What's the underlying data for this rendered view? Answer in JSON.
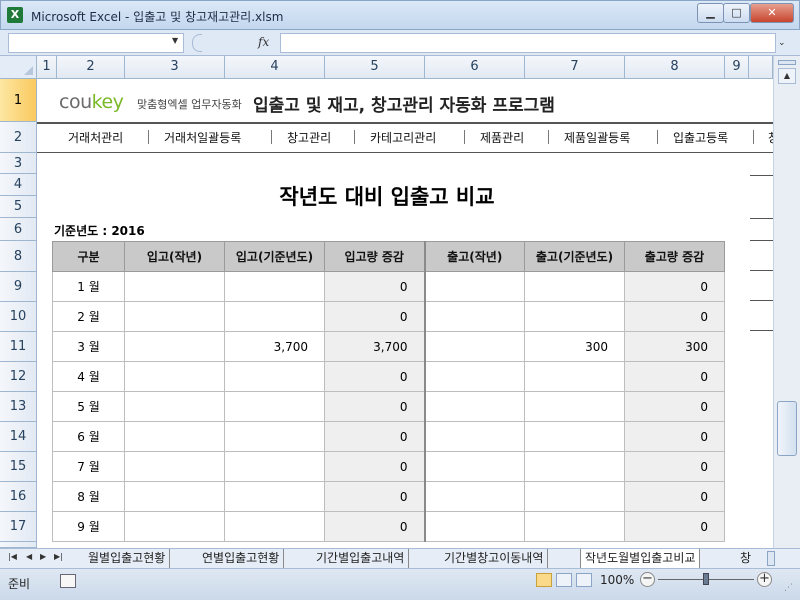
{
  "window": {
    "title": "Microsoft Excel - 입출고 및 창고재고관리.xlsm",
    "app_icon": "X",
    "minimize_icon": "minimize-icon",
    "maximize_icon": "maximize-icon",
    "close_icon": "close-icon"
  },
  "formula_bar": {
    "name_box": "",
    "fx_label": "fx",
    "formula": ""
  },
  "columns": [
    "1",
    "2",
    "3",
    "4",
    "5",
    "6",
    "7",
    "8",
    "9"
  ],
  "rows": [
    "1",
    "2",
    "3",
    "4",
    "5",
    "6",
    "8",
    "9",
    "10",
    "11",
    "12",
    "13",
    "14",
    "15",
    "16",
    "17"
  ],
  "selected_row": "1",
  "header": {
    "logo_main": "cou",
    "logo_accent": "key",
    "logo_sub": "맞춤형엑셀 업무자동화",
    "title": "입출고 및 재고, 창고관리 자동화 프로그램"
  },
  "nav": {
    "items": [
      "거래처관리",
      "거래처일괄등록",
      "창고관리",
      "카테고리관리",
      "제품관리",
      "제품일괄등록",
      "입출고등록",
      "창"
    ]
  },
  "report": {
    "title": "작년도 대비 입출고 비교",
    "base_year": "기준년도 : 2016"
  },
  "table": {
    "headers": [
      "구분",
      "입고(작년)",
      "입고(기준년도)",
      "입고량 증감",
      "출고(작년)",
      "출고(기준년도)",
      "출고량 증감"
    ],
    "rows": [
      [
        "1 월",
        "",
        "",
        "0",
        "",
        "",
        "0"
      ],
      [
        "2 월",
        "",
        "",
        "0",
        "",
        "",
        "0"
      ],
      [
        "3 월",
        "",
        "3,700",
        "3,700",
        "",
        "300",
        "300"
      ],
      [
        "4 월",
        "",
        "",
        "0",
        "",
        "",
        "0"
      ],
      [
        "5 월",
        "",
        "",
        "0",
        "",
        "",
        "0"
      ],
      [
        "6 월",
        "",
        "",
        "0",
        "",
        "",
        "0"
      ],
      [
        "7 월",
        "",
        "",
        "0",
        "",
        "",
        "0"
      ],
      [
        "8 월",
        "",
        "",
        "0",
        "",
        "",
        "0"
      ],
      [
        "9 월",
        "",
        "",
        "0",
        "",
        "",
        "0"
      ]
    ]
  },
  "sheet_tabs": {
    "items": [
      "월별입출고현황",
      "연별입출고현황",
      "기간별입출고내역",
      "기간별창고이동내역",
      "작년도월별입출고비교",
      "창"
    ],
    "active": "작년도월별입출고비교"
  },
  "status_bar": {
    "ready": "준비",
    "zoom": "100%",
    "zoom_minus": "−",
    "zoom_plus": "+"
  },
  "colors": {
    "logo_green": "#7bb928",
    "header_gray": "#c9c9c9",
    "selected_row": "#f9c95e"
  }
}
